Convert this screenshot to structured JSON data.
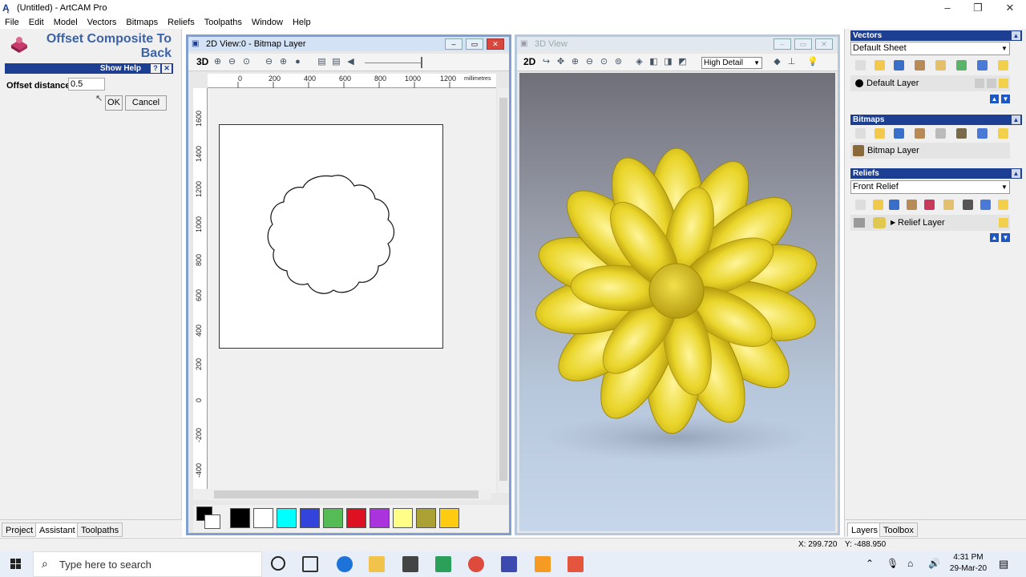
{
  "window": {
    "title": "(Untitled) - ArtCAM Pro",
    "app_icon": "artcam-logo-icon"
  },
  "menu": [
    "File",
    "Edit",
    "Model",
    "Vectors",
    "Bitmaps",
    "Reliefs",
    "Toolpaths",
    "Window",
    "Help"
  ],
  "assistant": {
    "title": "Offset Composite To Back",
    "show_help": "Show Help",
    "help_q": "?",
    "close": "✕",
    "offset_label": "Offset distance:",
    "offset_value": "0.5",
    "ok": "OK",
    "cancel": "Cancel"
  },
  "left_tabs": [
    "Project",
    "Assistant",
    "Toolpaths"
  ],
  "view2d": {
    "title": "2D View:0 - Bitmap Layer",
    "toggle": "3D",
    "units": "millimetres",
    "h_ticks": [
      "0",
      "200",
      "400",
      "600",
      "800",
      "1000",
      "1200"
    ],
    "v_ticks": [
      "1600",
      "1400",
      "1200",
      "1000",
      "800",
      "600",
      "400",
      "200",
      "0",
      "-200",
      "-400"
    ]
  },
  "palette": [
    "#000000",
    "#ffffff",
    "#00ffff",
    "#3344dd",
    "#55bb55",
    "#dd1122",
    "#aa33dd",
    "#ffff88",
    "#aaa033",
    "#ffcc11"
  ],
  "view3d": {
    "title": "3D View",
    "toggle": "2D",
    "detail": "High Detail"
  },
  "vectors": {
    "header": "Vectors",
    "sheet": "Default Sheet",
    "layer": "Default Layer"
  },
  "bitmaps": {
    "header": "Bitmaps",
    "layer": "Bitmap Layer"
  },
  "reliefs": {
    "header": "Reliefs",
    "relief": "Front Relief",
    "layer": "Relief Layer"
  },
  "right_tabs": [
    "Layers",
    "Toolbox"
  ],
  "status": {
    "x": "X: 299.720",
    "y": "Y: -488.950"
  },
  "taskbar": {
    "search_placeholder": "Type here to search",
    "time": "4:31 PM",
    "date": "29-Mar-20"
  }
}
